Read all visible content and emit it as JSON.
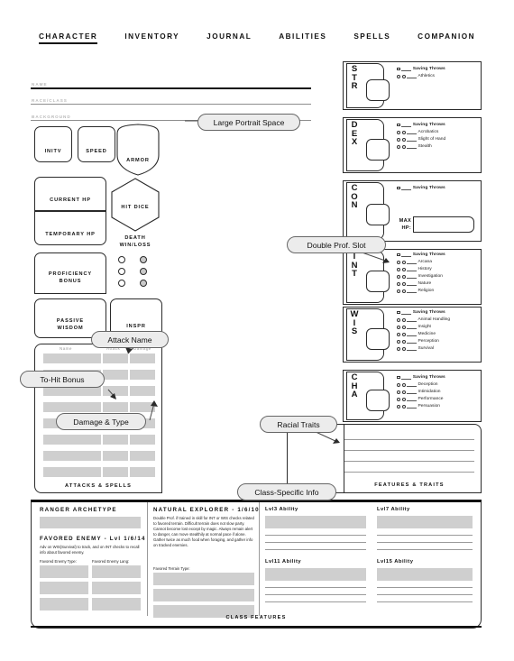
{
  "nav": {
    "items": [
      {
        "label": "CHARACTER",
        "active": true
      },
      {
        "label": "INVENTORY",
        "active": false
      },
      {
        "label": "JOURNAL",
        "active": false
      },
      {
        "label": "ABILITIES",
        "active": false
      },
      {
        "label": "SPELLS",
        "active": false
      },
      {
        "label": "COMPANION",
        "active": false
      }
    ]
  },
  "identity": {
    "name_label": "NAME",
    "race_class_label": "RACE/CLASS",
    "background_label": "BACKGROUND"
  },
  "left": {
    "initiative_label": "INITV",
    "speed_label": "SPEED",
    "armor_label": "ARMOR",
    "current_hp_label": "CURRENT HP",
    "temporary_hp_label": "TEMPORARY HP",
    "hit_dice_label": "HIT DICE",
    "death_label": "DEATH\nWIN/LOSS",
    "proficiency_label": "PROFICIENCY\nBONUS",
    "passive_wisdom_label": "PASSIVE\nWISDOM",
    "inspiration_label": "INSPR",
    "death_saves": {
      "rows": 3,
      "left_filled": false,
      "right_filled": true
    }
  },
  "attacks": {
    "columns": [
      "Name",
      "Attack",
      "Damage"
    ],
    "row_count": 8,
    "footer_label": "ATTACKS & SPELLS"
  },
  "abilities": [
    {
      "abbr": "STR",
      "letters": [
        "S",
        "T",
        "R"
      ],
      "saving_throw_label": "Saving Throws",
      "skills": [
        "Athletics"
      ]
    },
    {
      "abbr": "DEX",
      "letters": [
        "D",
        "E",
        "X"
      ],
      "saving_throw_label": "Saving Throws",
      "skills": [
        "Acrobatics",
        "Slight of Hand",
        "Stealth"
      ]
    },
    {
      "abbr": "CON",
      "letters": [
        "C",
        "O",
        "N"
      ],
      "saving_throw_label": "Saving Throws",
      "skills": [],
      "max_hp_label": "MAX\nHP:"
    },
    {
      "abbr": "INT",
      "letters": [
        "I",
        "N",
        "T"
      ],
      "saving_throw_label": "Saving Throws",
      "skills": [
        "Arcana",
        "History",
        "Investigation",
        "Nature",
        "Religion"
      ]
    },
    {
      "abbr": "WIS",
      "letters": [
        "W",
        "I",
        "S"
      ],
      "saving_throw_label": "Saving Throws",
      "skills": [
        "Animal Handling",
        "Insight",
        "Medicine",
        "Perception",
        "Survival"
      ]
    },
    {
      "abbr": "CHA",
      "letters": [
        "C",
        "H",
        "A"
      ],
      "saving_throw_label": "Saving Throws",
      "skills": [
        "Deception",
        "Intimidation",
        "Performance",
        "Persuasion"
      ]
    }
  ],
  "features": {
    "footer_label": "FEATURES & TRAITS",
    "line_count": 4
  },
  "class_features": {
    "footer_label": "CLASS FEATURES",
    "archetype_heading": "RANGER ARCHETYPE",
    "favored_enemy_heading": "FAVORED ENEMY - Lvl 1/6/14",
    "favored_enemy_text": "Adv on WIS(Survival) to track, and on INT checks to recall info about favored enemy.",
    "favored_enemy_type_label": "Favored Enemy Type:",
    "favored_enemy_lang_label": "Favored Enemy Lang:",
    "natural_explorer_heading": "NATURAL EXPLORER - 1/6/10",
    "natural_explorer_text": "Double Prof. if trained in skill for INT or WIS checks related to favored terrain. Difficult terrain does not slow party. Cannot become lost except by magic. Always remain alert to danger, can move stealthily at normal pace if alone. Gather twice as much food when foraging, and gather info on tracked enemies.",
    "favored_terrain_label": "Favored Terrain Type:",
    "level_abilities": [
      {
        "label": "Lvl3 Ability"
      },
      {
        "label": "Lvl7 Ability"
      },
      {
        "label": "Lvl11 Ability"
      },
      {
        "label": "Lvl15 Ability"
      }
    ]
  },
  "callouts": [
    {
      "id": "portrait",
      "label": "Large Portrait Space"
    },
    {
      "id": "attack_name",
      "label": "Attack Name"
    },
    {
      "id": "to_hit",
      "label": "To-Hit Bonus"
    },
    {
      "id": "damage_type",
      "label": "Damage & Type"
    },
    {
      "id": "double_prof",
      "label": "Double Prof. Slot"
    },
    {
      "id": "racial_traits",
      "label": "Racial Traits"
    },
    {
      "id": "class_specific",
      "label": "Class-Specific Info"
    }
  ],
  "colors": {
    "stroke": "#2a2a2a",
    "fill_placeholder": "#cfcfcf",
    "callout_bg": "#ececec",
    "muted_text": "#b9b9b9"
  }
}
